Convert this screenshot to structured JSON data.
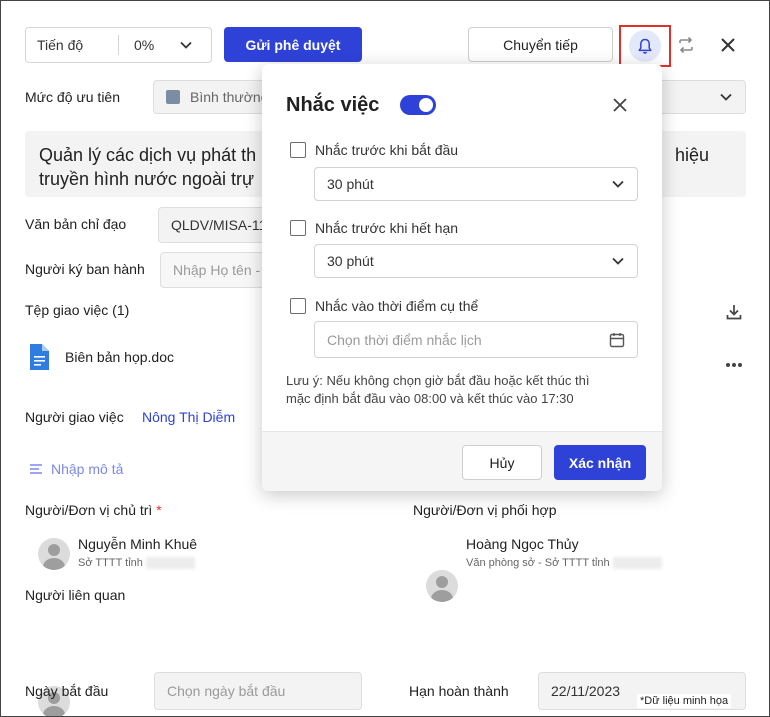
{
  "toolbar": {
    "progress_label": "Tiến độ",
    "progress_value": "0%",
    "submit_label": "Gửi phê duyệt",
    "forward_label": "Chuyển tiếp"
  },
  "form": {
    "priority_label": "Mức độ ưu tiên",
    "priority_value": "Bình thường",
    "title_line1": "Quản lý các dịch vụ phát th",
    "title_line1_end": "hiệu",
    "title_line2": "truyền hình nước ngoài trự",
    "directive_label": "Văn bản chỉ đạo",
    "directive_value": "QLDV/MISA-111",
    "signer_label": "Người ký ban hành",
    "signer_placeholder": "Nhập Họ tên -",
    "files_label": "Tệp giao việc (1)",
    "file_name": "Biên bản họp.doc",
    "assigner_label": "Người giao việc",
    "assigner_value": "Nông Thị Diễm",
    "description_link": "Nhập mô tả",
    "owner_label": "Người/Đơn vị chủ trì",
    "owner_required": "*",
    "owner_name": "Nguyễn Minh Khuê",
    "owner_unit": "Sở TTTT tỉnh",
    "coop_label": "Người/Đơn vị phối hợp",
    "coop_name": "Hoàng Ngọc Thủy",
    "coop_unit": "Văn phòng sở - Sở TTTT tỉnh",
    "related_label": "Người liên quan",
    "start_label": "Ngày bắt đầu",
    "start_placeholder": "Chọn ngày bắt đầu",
    "due_label": "Hạn hoàn thành",
    "due_value": "22/11/2023",
    "watermark": "*Dữ liệu minh họa"
  },
  "reminder": {
    "title": "Nhắc việc",
    "enabled": true,
    "option1_label": "Nhắc trước khi bắt đầu",
    "option1_value": "30 phút",
    "option2_label": "Nhắc trước khi hết hạn",
    "option2_value": "30 phút",
    "option3_label": "Nhắc vào thời điểm cụ thể",
    "option3_placeholder": "Chọn thời điểm nhắc lịch",
    "note_line1": "Lưu ý: Nếu không chọn giờ bắt đầu hoặc kết thúc thì",
    "note_line2": "mặc định bắt đầu vào 08:00 và kết thúc vào 17:30",
    "cancel_label": "Hủy",
    "confirm_label": "Xác nhận"
  },
  "colors": {
    "primary": "#2f42d8",
    "highlight_border": "#e0302c",
    "link": "#2f42d8"
  }
}
